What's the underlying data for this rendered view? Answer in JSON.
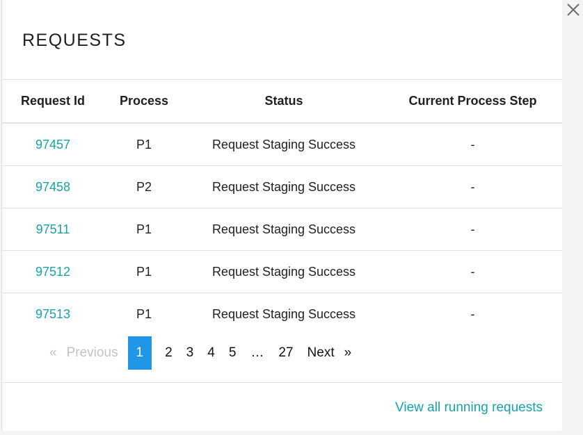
{
  "modal": {
    "title": "REQUESTS",
    "close_icon": "close-icon"
  },
  "table": {
    "headers": [
      "Request Id",
      "Process",
      "Status",
      "Current Process Step"
    ],
    "rows": [
      {
        "request_id": "97457",
        "process": "P1",
        "status": "Request Staging Success",
        "step": "-"
      },
      {
        "request_id": "97458",
        "process": "P2",
        "status": "Request Staging Success",
        "step": "-"
      },
      {
        "request_id": "97511",
        "process": "P1",
        "status": "Request Staging Success",
        "step": "-"
      },
      {
        "request_id": "97512",
        "process": "P1",
        "status": "Request Staging Success",
        "step": "-"
      },
      {
        "request_id": "97513",
        "process": "P1",
        "status": "Request Staging Success",
        "step": "-"
      }
    ]
  },
  "pagination": {
    "prev_icon": "«",
    "prev_label": "Previous",
    "pages": [
      "1",
      "2",
      "3",
      "4",
      "5"
    ],
    "ellipsis": "…",
    "last_page": "27",
    "current_page": "1",
    "next_label": "Next",
    "next_icon": "»"
  },
  "footer": {
    "link_label": "View all running requests"
  },
  "colors": {
    "link": "#17a2a8",
    "active_page": "#2196e6",
    "disabled": "#c2c2c2"
  }
}
